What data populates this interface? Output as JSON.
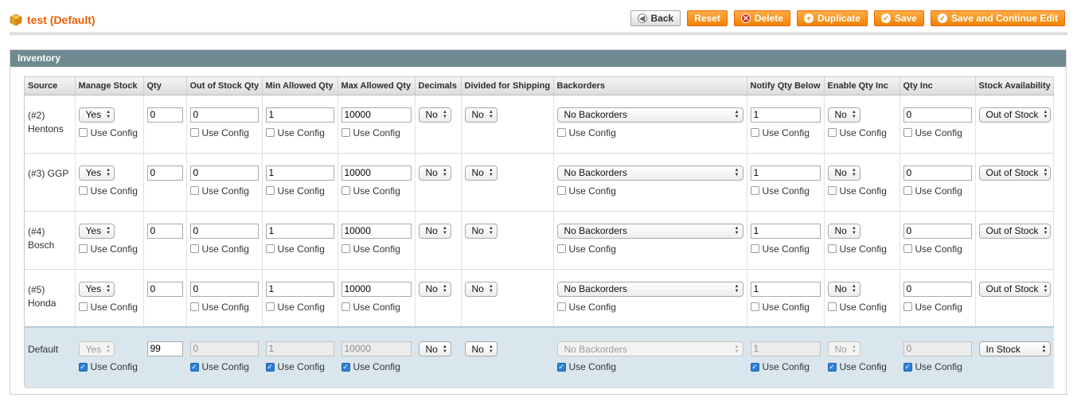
{
  "header": {
    "title": "test (Default)",
    "buttons": {
      "back": "Back",
      "reset": "Reset",
      "delete": "Delete",
      "duplicate": "Duplicate",
      "save": "Save",
      "save_continue": "Save and Continue Edit"
    }
  },
  "panel": {
    "title": "Inventory",
    "use_config_label": "Use Config",
    "columns": [
      "Source",
      "Manage Stock",
      "Qty",
      "Out of Stock Qty",
      "Min Allowed Qty",
      "Max Allowed Qty",
      "Decimals",
      "Divided for Shipping",
      "Backorders",
      "Notify Qty Below",
      "Enable Qty Inc",
      "Qty Inc",
      "Stock Availability"
    ],
    "rows": [
      {
        "source": "(#2) Hentons",
        "manage_stock": "Yes",
        "qty": "0",
        "out_of_stock_qty": "0",
        "min_allowed_qty": "1",
        "max_allowed_qty": "10000",
        "decimals": "No",
        "divided_shipping": "No",
        "backorders": "No Backorders",
        "notify_qty_below": "1",
        "enable_qty_inc": "No",
        "qty_inc": "0",
        "stock_availability": "Out of Stock"
      },
      {
        "source": "(#3) GGP",
        "manage_stock": "Yes",
        "qty": "0",
        "out_of_stock_qty": "0",
        "min_allowed_qty": "1",
        "max_allowed_qty": "10000",
        "decimals": "No",
        "divided_shipping": "No",
        "backorders": "No Backorders",
        "notify_qty_below": "1",
        "enable_qty_inc": "No",
        "qty_inc": "0",
        "stock_availability": "Out of Stock"
      },
      {
        "source": "(#4) Bosch",
        "manage_stock": "Yes",
        "qty": "0",
        "out_of_stock_qty": "0",
        "min_allowed_qty": "1",
        "max_allowed_qty": "10000",
        "decimals": "No",
        "divided_shipping": "No",
        "backorders": "No Backorders",
        "notify_qty_below": "1",
        "enable_qty_inc": "No",
        "qty_inc": "0",
        "stock_availability": "Out of Stock"
      },
      {
        "source": "(#5) Honda",
        "manage_stock": "Yes",
        "qty": "0",
        "out_of_stock_qty": "0",
        "min_allowed_qty": "1",
        "max_allowed_qty": "10000",
        "decimals": "No",
        "divided_shipping": "No",
        "backorders": "No Backorders",
        "notify_qty_below": "1",
        "enable_qty_inc": "No",
        "qty_inc": "0",
        "stock_availability": "Out of Stock"
      }
    ],
    "default_row": {
      "source": "Default",
      "manage_stock": "Yes",
      "qty": "99",
      "out_of_stock_qty": "0",
      "min_allowed_qty": "1",
      "max_allowed_qty": "10000",
      "decimals": "No",
      "divided_shipping": "No",
      "backorders": "No Backorders",
      "notify_qty_below": "1",
      "enable_qty_inc": "No",
      "qty_inc": "0",
      "stock_availability": "In Stock"
    }
  },
  "colors": {
    "accent": "#eb5e00",
    "button_orange": "#f18200",
    "panel_header": "#6f8992",
    "default_row_bg": "#dae6ee"
  }
}
